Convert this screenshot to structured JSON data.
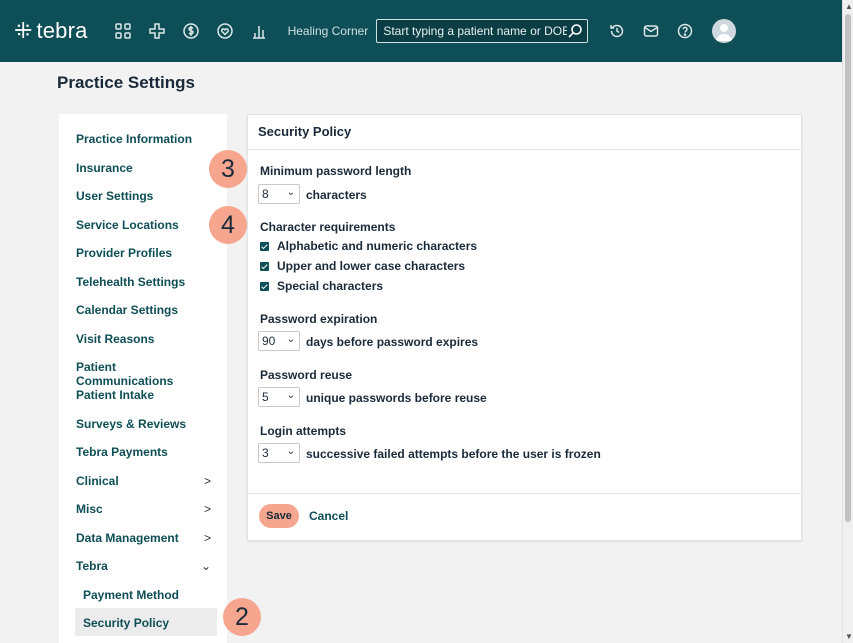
{
  "header": {
    "logo_text": "tebra",
    "practice_name": "Healing Corner",
    "search_placeholder": "Start typing a patient name or DOB"
  },
  "page": {
    "title": "Practice Settings"
  },
  "sidebar": {
    "items": [
      {
        "label": "Practice Information"
      },
      {
        "label": "Insurance"
      },
      {
        "label": "User Settings"
      },
      {
        "label": "Service Locations"
      },
      {
        "label": "Provider Profiles"
      },
      {
        "label": "Telehealth Settings"
      },
      {
        "label": "Calendar Settings"
      },
      {
        "label": "Visit Reasons"
      },
      {
        "label": "Patient Communications"
      },
      {
        "label": "Patient Intake"
      },
      {
        "label": "Surveys & Reviews"
      },
      {
        "label": "Tebra Payments"
      },
      {
        "label": "Clinical",
        "chevron": ">"
      },
      {
        "label": "Misc",
        "chevron": ">"
      },
      {
        "label": "Data Management",
        "chevron": ">"
      },
      {
        "label": "Tebra",
        "chevron": "⌄"
      }
    ],
    "sub_items": [
      {
        "label": "Payment Method"
      },
      {
        "label": "Security Policy"
      }
    ]
  },
  "panel": {
    "title": "Security Policy",
    "min_length": {
      "label": "Minimum password length",
      "value": "8",
      "suffix": "characters"
    },
    "char_req": {
      "label": "Character requirements",
      "options": [
        {
          "label": "Alphabetic and numeric characters",
          "checked": true
        },
        {
          "label": "Upper and lower case characters",
          "checked": true
        },
        {
          "label": "Special characters",
          "checked": true
        }
      ]
    },
    "expiration": {
      "label": "Password expiration",
      "value": "90",
      "suffix": "days before password expires"
    },
    "reuse": {
      "label": "Password reuse",
      "value": "5",
      "suffix": "unique passwords before reuse"
    },
    "login": {
      "label": "Login attempts",
      "value": "3",
      "suffix": "successive failed attempts before the user is frozen"
    },
    "save_label": "Save",
    "cancel_label": "Cancel"
  },
  "markers": {
    "m2": "2",
    "m3": "3",
    "m4": "4"
  },
  "colors": {
    "topbar": "#0e4e56",
    "accent": "#f6a58e",
    "link": "#0e4e56"
  }
}
